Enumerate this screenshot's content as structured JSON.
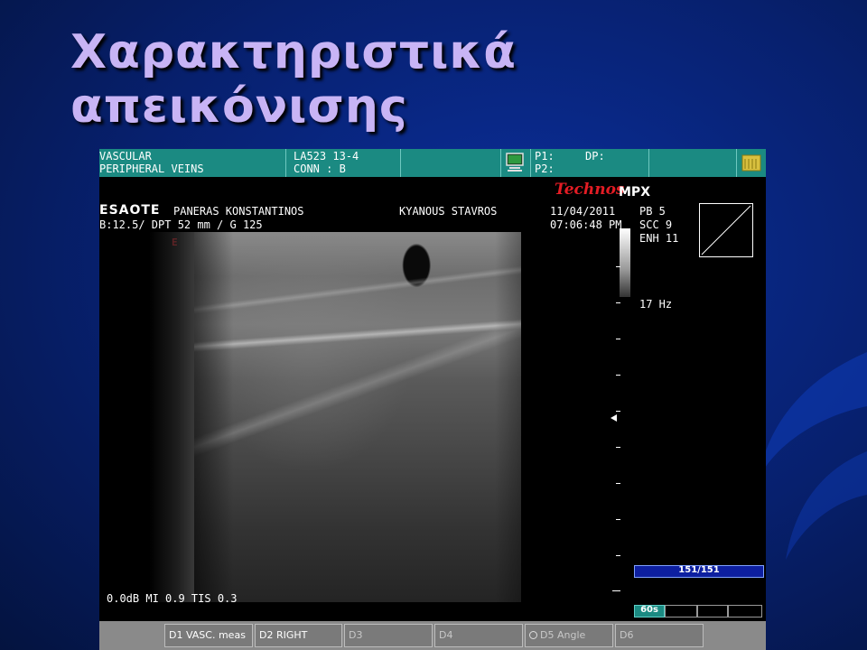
{
  "slide": {
    "title": "Χαρακτηριστικά απεικόνισης"
  },
  "header": {
    "exam_type": "VASCULAR",
    "exam_subtype": "PERIPHERAL VEINS",
    "probe": "LA523 13-4",
    "connector": "CONN : B",
    "p1": "P1:",
    "dp": "DP:",
    "p2": "P2:",
    "icons": {
      "monitor": "monitor-icon",
      "folder": "folder-icon"
    }
  },
  "info": {
    "brand": "ESAOTE",
    "operator": "PANERAS KONSTANTINOS",
    "patient": "KYANOUS STAVROS",
    "date": "11/04/2011",
    "time": "07:06:48 PM",
    "params_line": "B:12.5/ DPT 52 mm / G 125",
    "logo_technos": "Technos",
    "logo_mpx": "MPX",
    "orientation_mark": "E",
    "pb": "PB  5",
    "scc": "SCC 9",
    "enh": "ENH 11",
    "frame_rate": "17 Hz",
    "output_line": "0.0dB MI 0.9 TIS 0.3"
  },
  "cine": {
    "counter": "151/151",
    "duration_btn": "60s"
  },
  "softkeys": [
    {
      "label": "D1 VASC. meas",
      "enabled": true
    },
    {
      "label": "D2 RIGHT",
      "enabled": true
    },
    {
      "label": "D3",
      "enabled": false
    },
    {
      "label": "D4",
      "enabled": false
    },
    {
      "label": "D5 Angle",
      "enabled": false
    },
    {
      "label": "D6",
      "enabled": false
    }
  ],
  "colors": {
    "header_teal": "#1b8a82",
    "technos_red": "#e31c24",
    "counter_blue": "#0d1fa0",
    "title_lavender": "#c8b4f5"
  }
}
